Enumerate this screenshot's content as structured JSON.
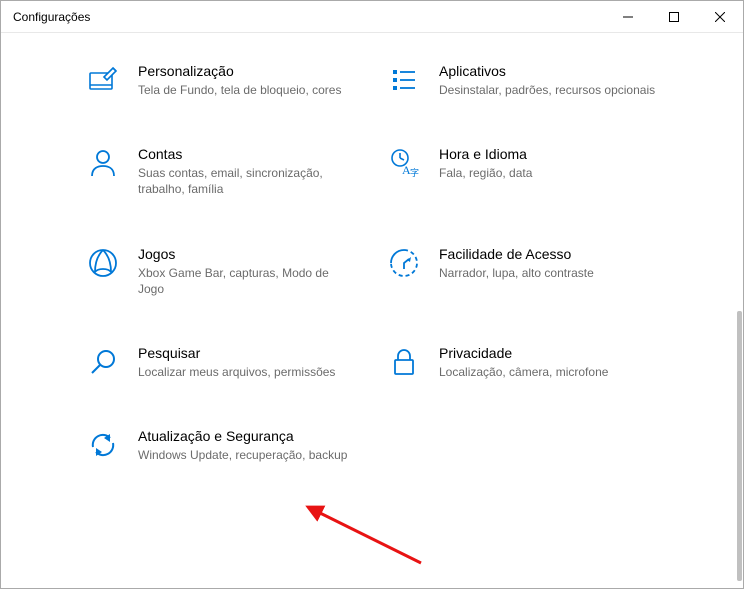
{
  "titlebar": {
    "title": "Configurações"
  },
  "categories": [
    {
      "key": "personalization",
      "title": "Personalização",
      "desc": "Tela de Fundo, tela de bloqueio, cores"
    },
    {
      "key": "apps",
      "title": "Aplicativos",
      "desc": "Desinstalar, padrões, recursos opcionais"
    },
    {
      "key": "accounts",
      "title": "Contas",
      "desc": "Suas contas, email, sincronização, trabalho, família"
    },
    {
      "key": "time",
      "title": "Hora e Idioma",
      "desc": "Fala, região, data"
    },
    {
      "key": "gaming",
      "title": "Jogos",
      "desc": "Xbox Game Bar, capturas, Modo de Jogo"
    },
    {
      "key": "ease",
      "title": "Facilidade de Acesso",
      "desc": "Narrador, lupa, alto contraste"
    },
    {
      "key": "search",
      "title": "Pesquisar",
      "desc": "Localizar meus arquivos, permissões"
    },
    {
      "key": "privacy",
      "title": "Privacidade",
      "desc": "Localização, câmera, microfone"
    },
    {
      "key": "update",
      "title": "Atualização e Segurança",
      "desc": "Windows Update, recuperação, backup"
    }
  ]
}
